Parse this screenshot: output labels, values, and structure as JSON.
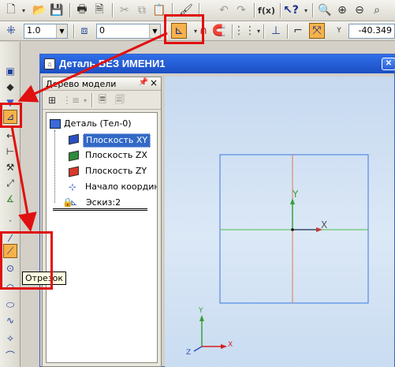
{
  "toolbar_top": {
    "icons": [
      "new-document-icon",
      "open-folder-icon",
      "save-icon",
      "print-icon",
      "print-preview-icon",
      "cut-icon",
      "copy-icon",
      "paste-icon",
      "format-painter-icon",
      "undo-icon",
      "redo-icon",
      "function-icon",
      "help-icon",
      "zoom-window-icon",
      "zoom-in-icon",
      "zoom-out-icon"
    ],
    "fx_label": "f(x)"
  },
  "toolbar_props": {
    "line_width": "1.0",
    "layer": "0",
    "coord_y_label": "Y",
    "coord_x_value": "-40.349"
  },
  "document": {
    "title": "Деталь БЕЗ ИМЕНИ1"
  },
  "tree": {
    "title": "Дерево модели",
    "root": "Деталь (Тел-0)",
    "items": [
      {
        "label": "Плоскость XY",
        "color": "#2a4fc4"
      },
      {
        "label": "Плоскость ZX",
        "color": "#2e8b3a"
      },
      {
        "label": "Плоскость ZY",
        "color": "#d83a2c"
      },
      {
        "label": "Начало координа"
      },
      {
        "label": "Эскиз:2"
      }
    ]
  },
  "canvas": {
    "axis_y_label": "Y",
    "axis_x_label": "X",
    "mini_axis_y_label": "Y",
    "mini_axis_x_label": "X",
    "mini_axis_z_label": "Z"
  },
  "tooltip": {
    "text": "Отрезок"
  },
  "colors": {
    "highlight_red": "#e01010",
    "title_blue": "#1b4fc4",
    "active_tool_orange": "#f6b24a"
  }
}
